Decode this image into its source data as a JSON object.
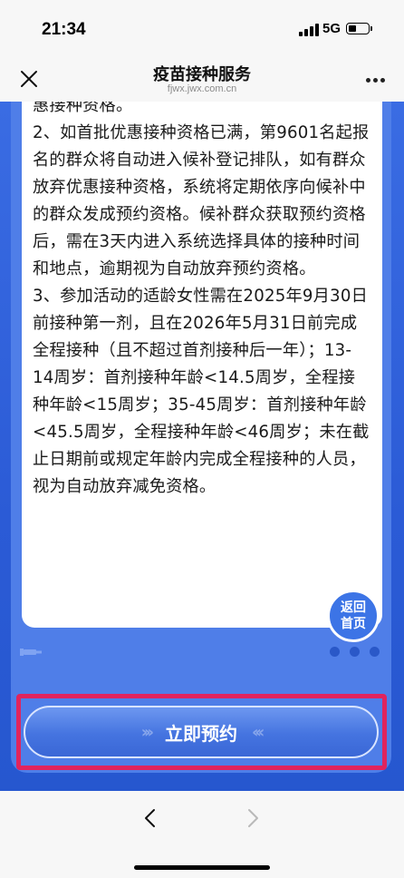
{
  "status": {
    "time": "21:34",
    "network": "5G"
  },
  "nav": {
    "title": "疫苗接种服务",
    "subtitle": "fjwx.jwx.com.cn"
  },
  "notice": {
    "text": "惠接种资格。\n2、如首批优惠接种资格已满，第9601名起报名的群众将自动进入候补登记排队，如有群众放弃优惠接种资格，系统将定期依序向候补中的群众发成预约资格。候补群众获取预约资格后，需在3天内进入系统选择具体的接种时间和地点，逾期视为自动放弃预约资格。\n3、参加活动的适龄女性需在2025年9月30日前接种第一剂，且在2026年5月31日前完成全程接种（且不超过首剂接种后一年）；13-14周岁：首剂接种年龄<14.5周岁，全程接种年龄<15周岁；35-45周岁：首剂接种年龄<45.5周岁，全程接种年龄<46周岁；未在截止日期前或规定年龄内完成全程接种的人员，视为自动放弃减免资格。"
  },
  "back_home": {
    "line1": "返回",
    "line2": "首页"
  },
  "book_button": {
    "label": "立即预约"
  },
  "colors": {
    "accent": "#2c5fd9",
    "highlight": "#e0245e"
  }
}
